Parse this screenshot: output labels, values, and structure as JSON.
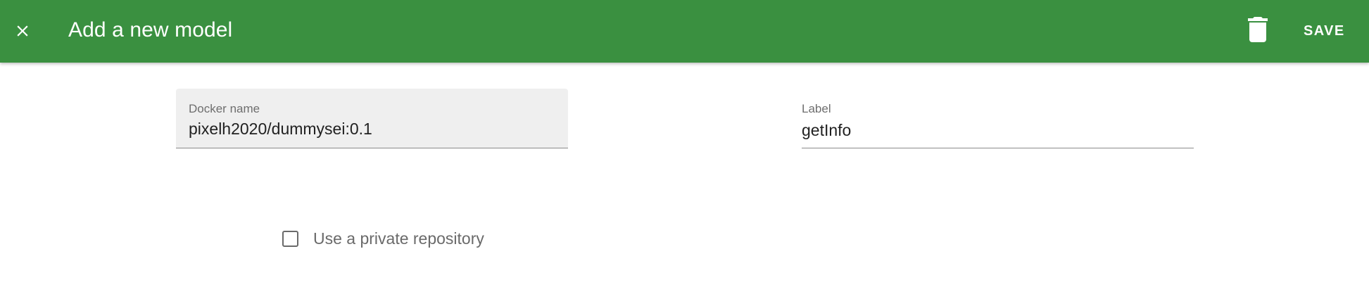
{
  "header": {
    "title": "Add a new model",
    "close_icon": "close-icon",
    "delete_icon": "trash-icon",
    "save_label": "SAVE",
    "background_color": "#3a9040"
  },
  "form": {
    "docker_name": {
      "label": "Docker name",
      "value": "pixelh2020/dummysei:0.1"
    },
    "label_field": {
      "label": "Label",
      "value": "getInfo"
    },
    "private_repo": {
      "label": "Use a private repository",
      "checked": false
    }
  }
}
